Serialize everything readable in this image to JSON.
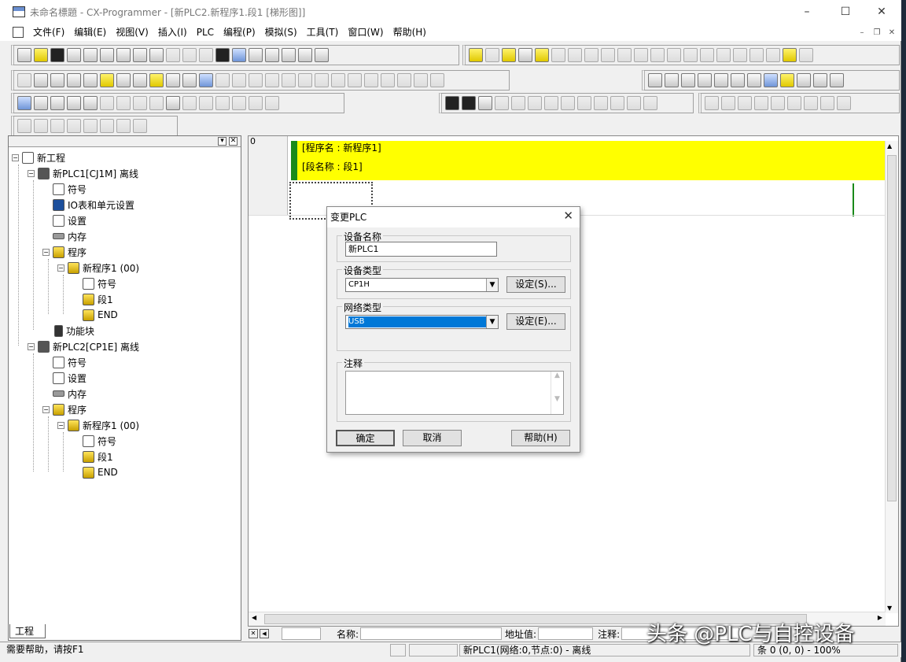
{
  "window": {
    "title": "未命名標題 - CX-Programmer - [新PLC2.新程序1.段1 [梯形图]]",
    "controls": [
      "–",
      "☐",
      "✕"
    ]
  },
  "menu": [
    "文件(F)",
    "编辑(E)",
    "视图(V)",
    "插入(I)",
    "PLC",
    "编程(P)",
    "模拟(S)",
    "工具(T)",
    "窗口(W)",
    "帮助(H)"
  ],
  "tree": {
    "root": "新工程",
    "plc1": {
      "label": "新PLC1[CJ1M] 离线",
      "symbols": "符号",
      "io": "IO表和单元设置",
      "settings": "设置",
      "memory": "内存",
      "programs": "程序",
      "program1": "新程序1 (00)",
      "p_symbols": "符号",
      "section": "段1",
      "end": "END",
      "fb": "功能块"
    },
    "plc2": {
      "label": "新PLC2[CP1E] 离线",
      "symbols": "符号",
      "settings": "设置",
      "memory": "内存",
      "programs": "程序",
      "program1": "新程序1 (00)",
      "p_symbols": "符号",
      "section": "段1",
      "end": "END"
    },
    "tab": "工程"
  },
  "ladder": {
    "rung_number": "0",
    "program_name": "[程序名 : 新程序1]",
    "section_name": "[段名称 : 段1]"
  },
  "infobar": {
    "name_label": "名称:",
    "address_label": "地址值:",
    "comment_label": "注释:"
  },
  "status": {
    "help": "需要帮助，请按F1",
    "plc": "新PLC1(网络:0,节点:0) - 离线",
    "position": "条 0 (0, 0)  - 100%"
  },
  "dialog": {
    "title": "变更PLC",
    "device_name_label": "设备名称",
    "device_name_value": "新PLC1",
    "device_type_label": "设备类型",
    "device_type_value": "CP1H",
    "device_settings_btn": "设定(S)...",
    "network_type_label": "网络类型",
    "network_type_value": "USB",
    "network_settings_btn": "设定(E)...",
    "comment_label": "注释",
    "ok_btn": "确定",
    "cancel_btn": "取消",
    "help_btn": "帮助(H)"
  },
  "watermark": "头条 @PLC与自控设备"
}
